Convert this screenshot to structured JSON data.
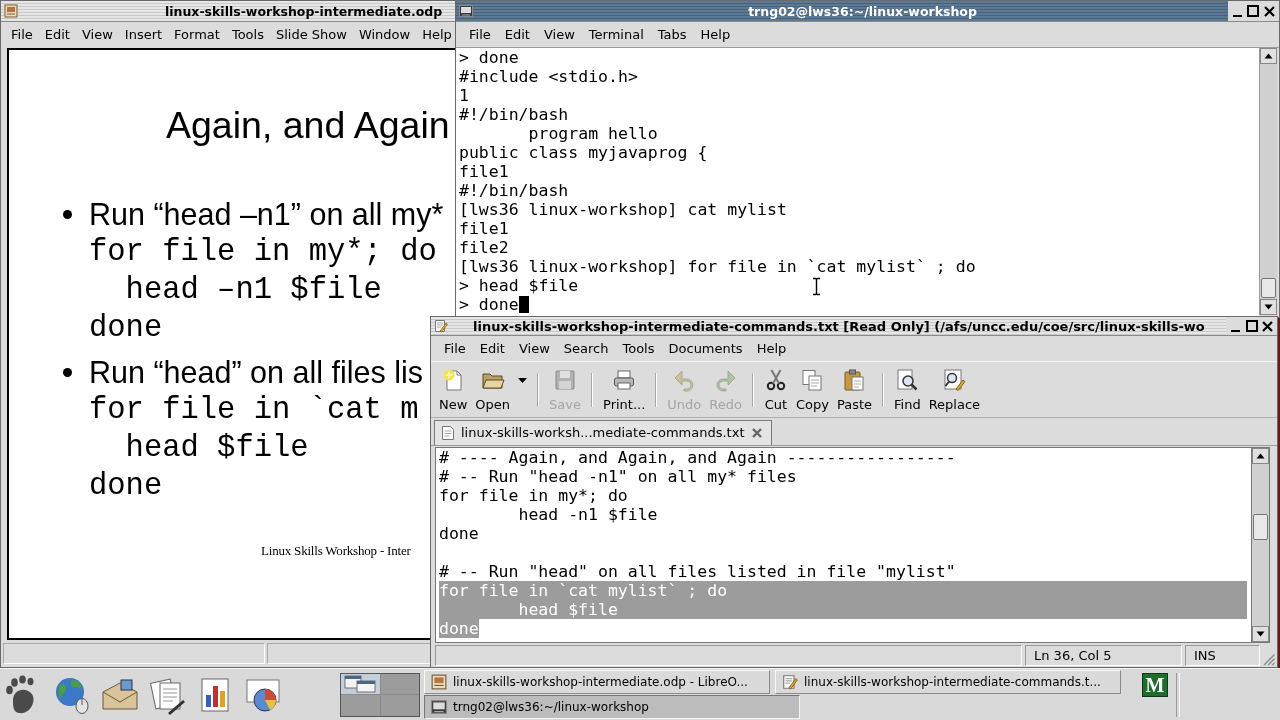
{
  "presentation_window": {
    "title": "linux-skills-workshop-intermediate.odp",
    "active": false,
    "menu": [
      "File",
      "Edit",
      "View",
      "Insert",
      "Format",
      "Tools",
      "Slide Show",
      "Window",
      "Help"
    ],
    "slide": {
      "title": "Again, and Again",
      "items": [
        {
          "kind": "bullet",
          "text": "Run “head –n1” on all my*"
        },
        {
          "kind": "code",
          "text": "for file in my*; do"
        },
        {
          "kind": "code",
          "text": "  head –n1 $file"
        },
        {
          "kind": "code",
          "text": "done"
        },
        {
          "kind": "bullet",
          "text": "Run “head” on all files lis"
        },
        {
          "kind": "code",
          "text": "for file in `cat m"
        },
        {
          "kind": "code",
          "text": "  head $file"
        },
        {
          "kind": "code",
          "text": "done"
        }
      ],
      "footer": "Linux Skills Workshop - Inter"
    }
  },
  "terminal_window": {
    "title": "trng02@lws36:~/linux-workshop",
    "active": true,
    "menu": [
      "File",
      "Edit",
      "View",
      "Terminal",
      "Tabs",
      "Help"
    ],
    "lines": [
      "> done",
      "#include <stdio.h>",
      "1",
      "#!/bin/bash",
      "       program hello",
      "public class myjavaprog {",
      "file1",
      "#!/bin/bash",
      "[lws36 linux-workshop] cat mylist",
      "file1",
      "file2",
      "[lws36 linux-workshop] for file in `cat mylist` ; do",
      "> head $file",
      "> done"
    ],
    "cursor": true
  },
  "editor_window": {
    "title": "linux-skills-workshop-intermediate-commands.txt [Read Only] (/afs/uncc.edu/coe/src/linux-skills-wo",
    "active": false,
    "menu": [
      "File",
      "Edit",
      "View",
      "Search",
      "Tools",
      "Documents",
      "Help"
    ],
    "toolbar": [
      {
        "buttons": [
          {
            "label": "New",
            "disabled": false,
            "dropdown": false
          },
          {
            "label": "Open",
            "disabled": false,
            "dropdown": true
          }
        ]
      },
      {
        "buttons": [
          {
            "label": "Save",
            "disabled": true,
            "dropdown": false
          }
        ]
      },
      {
        "buttons": [
          {
            "label": "Print...",
            "disabled": false,
            "dropdown": false
          }
        ]
      },
      {
        "buttons": [
          {
            "label": "Undo",
            "disabled": true,
            "dropdown": false
          },
          {
            "label": "Redo",
            "disabled": true,
            "dropdown": false
          }
        ]
      },
      {
        "buttons": [
          {
            "label": "Cut",
            "disabled": false,
            "dropdown": false
          },
          {
            "label": "Copy",
            "disabled": false,
            "dropdown": false
          },
          {
            "label": "Paste",
            "disabled": false,
            "dropdown": false
          }
        ]
      },
      {
        "buttons": [
          {
            "label": "Find",
            "disabled": false,
            "dropdown": false
          },
          {
            "label": "Replace",
            "disabled": false,
            "dropdown": false
          }
        ]
      }
    ],
    "tabs": [
      {
        "label": "linux-skills-worksh...mediate-commands.txt",
        "selected": true
      }
    ],
    "lines": [
      {
        "text": "# ---- Again, and Again, and Again -----------------",
        "selected": false,
        "gap_before": false
      },
      {
        "text": "# -- Run \"head -n1\" on all my* files",
        "selected": false,
        "gap_before": false
      },
      {
        "text": "for file in my*; do",
        "selected": false,
        "gap_before": false
      },
      {
        "text": "        head -n1 $file",
        "selected": false,
        "gap_before": false
      },
      {
        "text": "done",
        "selected": false,
        "gap_before": false
      },
      {
        "text": "# -- Run \"head\" on all files listed in file \"mylist\"",
        "selected": false,
        "gap_before": true
      },
      {
        "text": "for file in `cat mylist` ; do",
        "selected": true,
        "gap_before": false
      },
      {
        "text": "        head $file",
        "selected": true,
        "gap_before": false
      },
      {
        "text": "done",
        "selected": true,
        "gap_before": false
      }
    ],
    "status": [
      "Ln 36, Col 5",
      "INS"
    ]
  },
  "taskbar": {
    "workspaces": [
      {
        "selected": true
      },
      {
        "selected": false
      },
      {
        "selected": false
      },
      {
        "selected": false
      }
    ],
    "tasks": [
      {
        "kind": "presentation",
        "label": "linux-skills-workshop-intermediate.odp - LibreO...",
        "selected": false
      },
      {
        "kind": "editor",
        "label": "linux-skills-workshop-intermediate-commands.t...",
        "selected": false
      },
      {
        "kind": "terminal",
        "label": "trng02@lws36:~/linux-workshop",
        "selected": true
      }
    ],
    "tray": [
      {
        "label": "M"
      }
    ]
  }
}
